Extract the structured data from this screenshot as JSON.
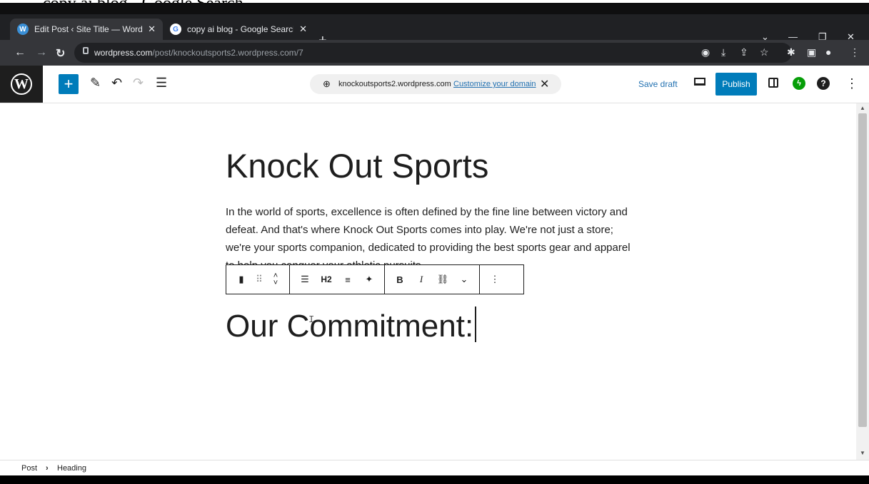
{
  "overlay_caption": "copy ai blog - Google Search",
  "browser": {
    "tabs": [
      {
        "title": "Edit Post ‹ Site Title — WordPress",
        "active": true,
        "favicon": "wordpress-icon"
      },
      {
        "title": "copy ai blog - Google Search",
        "active": false,
        "favicon": "google-icon"
      }
    ],
    "url_domain": "wordpress.com",
    "url_path": "/post/knockoutsports2.wordpress.com/7"
  },
  "editor": {
    "add_block_symbol": "+",
    "domain": "knockoutsports2.wordpress.com",
    "customize_domain": "Customize your domain",
    "save_draft": "Save draft",
    "publish": "Publish"
  },
  "post": {
    "title": "Knock Out Sports",
    "paragraph": "In the world of sports, excellence is often defined by the fine line between victory and defeat. And that's where Knock Out Sports comes into play. We're not just a store; we're your sports companion, dedicated to providing the best sports gear and apparel to help you conquer your athletic pursuits.",
    "heading": "Our Commitment:"
  },
  "block_toolbar": {
    "heading_level": "H2",
    "bold": "B",
    "italic": "I"
  },
  "breadcrumb": {
    "item1": "Post",
    "separator": "›",
    "item2": "Heading"
  },
  "colors": {
    "wp_blue": "#007cba",
    "chrome_dark": "#202124",
    "jetpack_green": "#069e08"
  }
}
